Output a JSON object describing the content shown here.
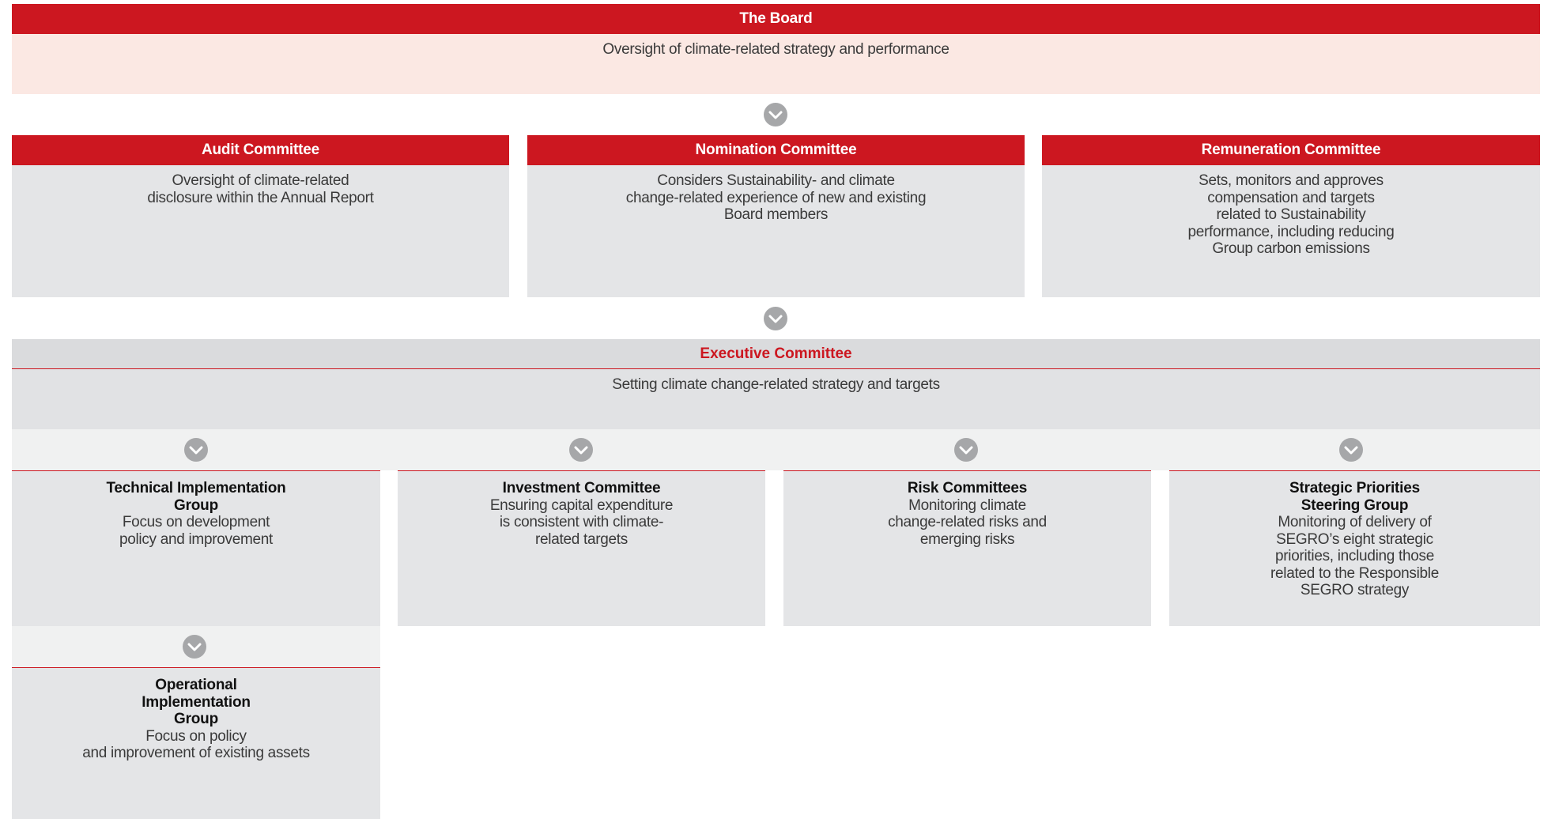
{
  "board": {
    "title": "The Board",
    "description": "Oversight of climate-related strategy and performance"
  },
  "committees": [
    {
      "title": "Audit Committee",
      "description": "Oversight of climate-related\ndisclosure within the Annual Report"
    },
    {
      "title": "Nomination Committee",
      "description": "Considers Sustainability- and climate\nchange-related experience of new and existing\nBoard members"
    },
    {
      "title": "Remuneration Committee",
      "description": "Sets, monitors and approves\ncompensation and targets\nrelated to Sustainability\nperformance, including reducing\nGroup carbon emissions"
    }
  ],
  "executive": {
    "title": "Executive Committee",
    "description": "Setting climate change-related strategy and targets"
  },
  "groups": [
    {
      "title": "Technical Implementation\nGroup",
      "description": "Focus on development\npolicy and improvement"
    },
    {
      "title": "Investment Committee",
      "description": "Ensuring capital expenditure\nis consistent with climate-\nrelated targets"
    },
    {
      "title": "Risk Committees",
      "description": "Monitoring climate\nchange-related risks and\nemerging risks"
    },
    {
      "title": "Strategic Priorities\nSteering Group",
      "description": "Monitoring of delivery of\nSEGRO’s eight strategic\npriorities, including those\nrelated to the Responsible\nSEGRO strategy"
    }
  ],
  "operational": {
    "title": "Operational\nImplementation\nGroup",
    "description": "Focus on policy\nand improvement of existing assets"
  },
  "colors": {
    "brand_red": "#cc1720",
    "board_body": "#fbe8e3",
    "panel_grey": "#e4e5e7",
    "chevron_grey": "#a6a7a9"
  },
  "icons": {
    "connector": "chevron-down-icon"
  }
}
